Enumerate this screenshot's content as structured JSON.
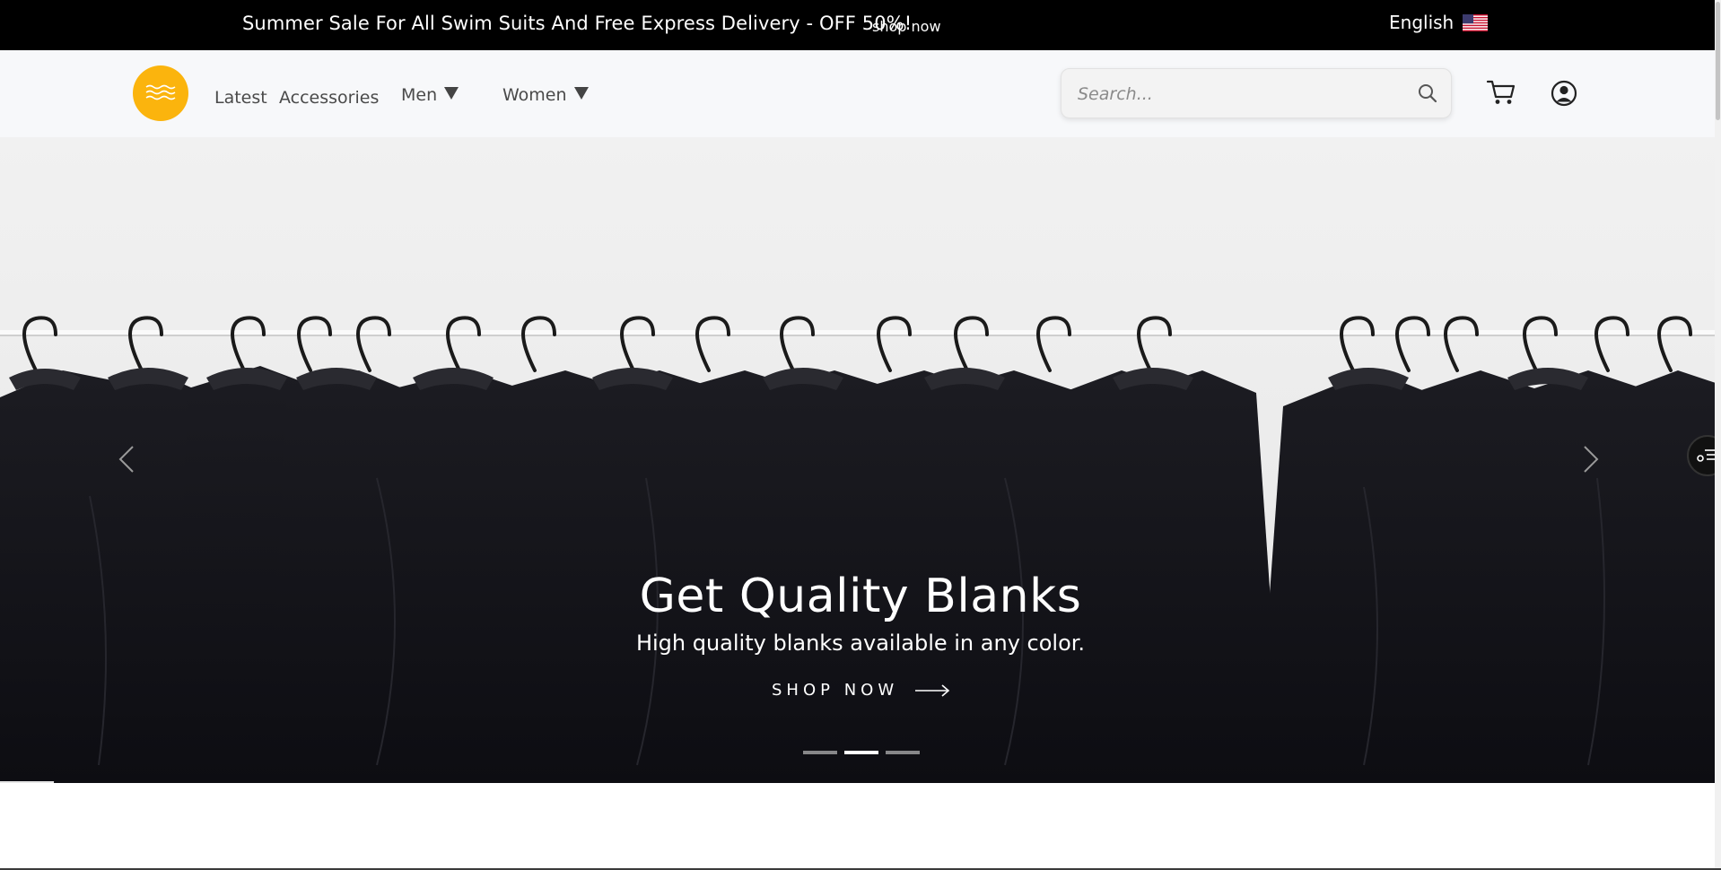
{
  "announcement": {
    "message": "Summer Sale For All Swim Suits And Free Express Delivery - OFF 50%!",
    "link": "shop now",
    "language": "English"
  },
  "nav": {
    "latest": "Latest",
    "accessories": "Accessories",
    "men": "Men",
    "women": "Women"
  },
  "search": {
    "placeholder": "Search..."
  },
  "icons": {
    "logo": "waves-icon",
    "flag": "us-flag-icon",
    "search": "search-icon",
    "cart": "cart-icon",
    "account": "user-circle-icon",
    "prev": "chevron-left-icon",
    "next": "chevron-right-icon",
    "cta": "arrow-right-icon",
    "widget": "filter-list-icon"
  },
  "hero": {
    "title": "Get Quality Blanks",
    "subtitle": "High quality blanks available in any color.",
    "cta": "SHOP NOW",
    "slide_count": 3,
    "active_slide": 2
  },
  "colors": {
    "announcement_bg": "#000000",
    "header_bg": "#f7f8fa",
    "logo": "#fbb40d",
    "hero_text": "#ffffff"
  }
}
